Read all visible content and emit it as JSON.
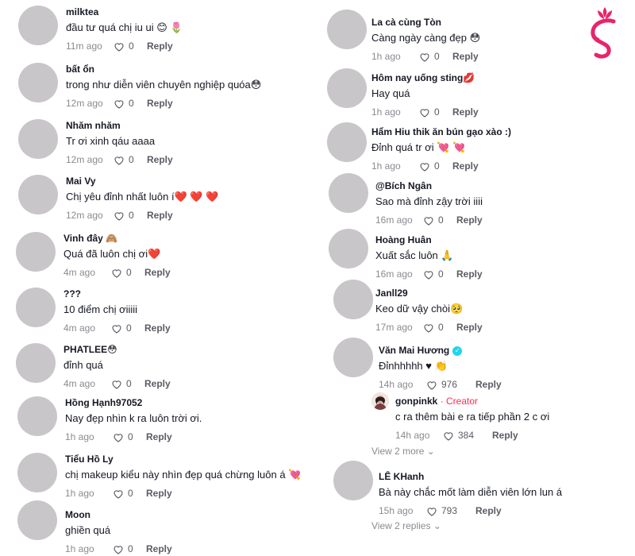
{
  "left_comments": [
    {
      "user": "milktea",
      "text": "đầu tư quá chị iu ui 😊 🌷",
      "time": "11m ago",
      "likes": "0",
      "reply": "Reply"
    },
    {
      "user": "bất ổn",
      "text": "trong như diễn viên chuyên nghiệp quóa😳",
      "time": "12m ago",
      "likes": "0",
      "reply": "Reply"
    },
    {
      "user": "Nhăm nhăm",
      "text": "Tr ơi xinh qáu aaaa",
      "time": "12m ago",
      "likes": "0",
      "reply": "Reply"
    },
    {
      "user": "Mai Vy",
      "text": "Chị yêu đỉnh nhất luôn í❤️ ❤️ ❤️",
      "time": "12m ago",
      "likes": "0",
      "reply": "Reply"
    },
    {
      "user": "Vinh đây 🙈",
      "text": "Quá đã luôn chị ơi❤️",
      "time": "4m ago",
      "likes": "0",
      "reply": "Reply"
    },
    {
      "user": "???",
      "text": "10 điểm chị ơiiiii",
      "time": "4m ago",
      "likes": "0",
      "reply": "Reply"
    },
    {
      "user": "PHATLEE😳",
      "text": "đỉnh quá",
      "time": "4m ago",
      "likes": "0",
      "reply": "Reply"
    },
    {
      "user": "Hồng Hạnh97052",
      "text": "Nay đẹp nhìn k ra luôn trời ơi.",
      "time": "1h ago",
      "likes": "0",
      "reply": "Reply"
    },
    {
      "user": "Tiểu Hồ Ly",
      "text": "chị makeup kiểu này nhìn đẹp quá chừng luôn á 💘",
      "time": "1h ago",
      "likes": "0",
      "reply": "Reply"
    },
    {
      "user": "Moon",
      "text": "ghiền quá",
      "time": "1h ago",
      "likes": "0",
      "reply": "Reply"
    }
  ],
  "right_comments": [
    {
      "user": "La cà cùng Tòn",
      "text": "Càng ngày càng đẹp 😳",
      "time": "1h ago",
      "likes": "0",
      "reply": "Reply"
    },
    {
      "user": "Hôm nay uống sting💋",
      "text": "Hay quá",
      "time": "1h ago",
      "likes": "0",
      "reply": "Reply"
    },
    {
      "user": "Hẩm Hiu thik ăn bún gạo xào :)",
      "text": "Đỉnh quá tr ơi 💘 💘",
      "time": "1h ago",
      "likes": "0",
      "reply": "Reply"
    },
    {
      "user": "@Bích Ngân",
      "text": "Sao mà đỉnh zậy trời iiii",
      "time": "16m ago",
      "likes": "0",
      "reply": "Reply"
    },
    {
      "user": "Hoàng Huân",
      "text": "Xuất sắc luôn 🙏",
      "time": "16m ago",
      "likes": "0",
      "reply": "Reply"
    },
    {
      "user": "Janll29",
      "text": "Keo dữ vậy chòi🥺",
      "time": "17m ago",
      "likes": "0",
      "reply": "Reply"
    },
    {
      "user": "Văn Mai Hương",
      "text": "Đỉnhhhhh ♥ 👏",
      "time": "14h ago",
      "likes": "976",
      "reply": "Reply"
    },
    {
      "user": "LÊ KHanh",
      "text": "Bà này chắc mốt làm diễn viên lớn lun á",
      "time": "15h ago",
      "likes": "793",
      "reply": "Reply"
    }
  ],
  "creator_reply": {
    "user": "gonpinkk",
    "badge": "· Creator",
    "text": "c ra thêm bài e ra tiếp phần 2 c ơi",
    "time": "14h ago",
    "likes": "384",
    "reply": "Reply"
  },
  "view_more_1": "View 2 more ⌄",
  "view_more_2": "View 2 replies ⌄",
  "colors": {
    "avatar": "#c9c6c9",
    "creator": "#fe2c55",
    "logo": "#e8246a"
  }
}
